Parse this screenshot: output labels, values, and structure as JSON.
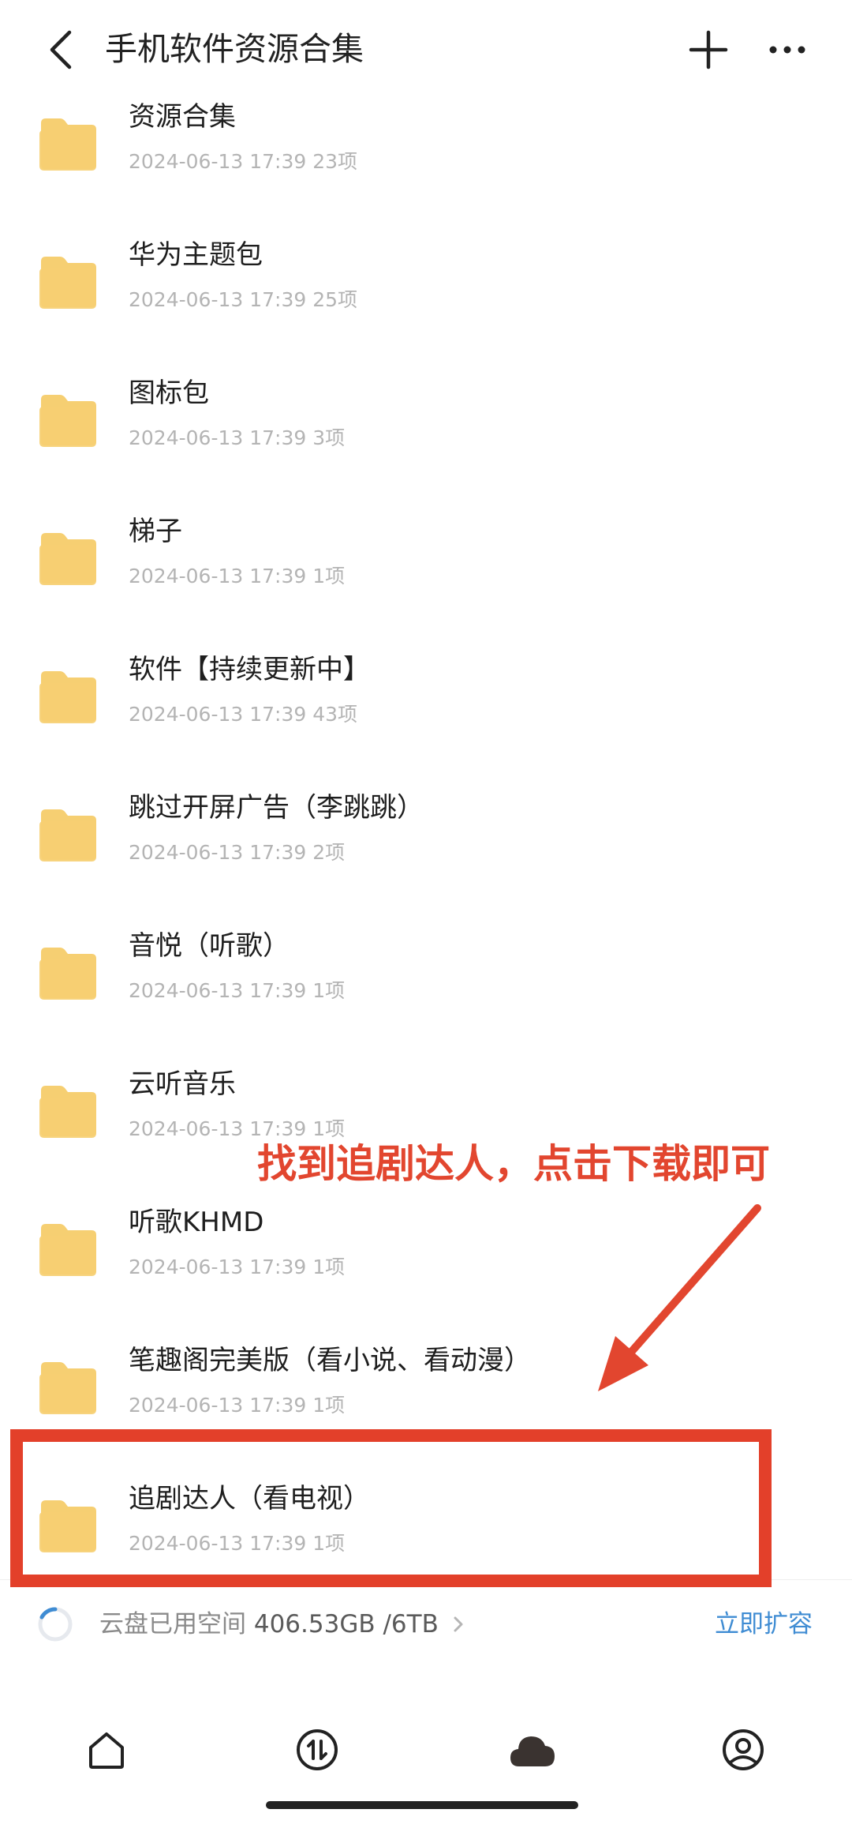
{
  "header": {
    "title": "手机软件资源合集",
    "back_icon": "chevron-left-icon",
    "add_icon": "plus-icon",
    "more_icon": "more-horizontal-icon"
  },
  "files": [
    {
      "name": "资源合集",
      "date": "2024-06-13 17:39",
      "count": "23项"
    },
    {
      "name": "华为主题包",
      "date": "2024-06-13 17:39",
      "count": "25项"
    },
    {
      "name": "图标包",
      "date": "2024-06-13 17:39",
      "count": "3项"
    },
    {
      "name": "梯子",
      "date": "2024-06-13 17:39",
      "count": "1项"
    },
    {
      "name": "软件【持续更新中】",
      "date": "2024-06-13 17:39",
      "count": "43项"
    },
    {
      "name": "跳过开屏广告（李跳跳）",
      "date": "2024-06-13 17:39",
      "count": "2项"
    },
    {
      "name": "音悦（听歌）",
      "date": "2024-06-13 17:39",
      "count": "1项"
    },
    {
      "name": "云听音乐",
      "date": "2024-06-13 17:39",
      "count": "1项"
    },
    {
      "name": "听歌KHMD",
      "date": "2024-06-13 17:39",
      "count": "1项"
    },
    {
      "name": "笔趣阁完美版（看小说、看动漫）",
      "date": "2024-06-13 17:39",
      "count": "1项"
    },
    {
      "name": "追剧达人（看电视）",
      "date": "2024-06-13 17:39",
      "count": "1项"
    }
  ],
  "annotation": {
    "text": "找到追剧达人，点击下载即可",
    "color": "#e2462f"
  },
  "storage": {
    "label": "云盘已用空间",
    "used": "406.53GB /6TB",
    "expand_label": "立即扩容",
    "accent": "#3f8cd3"
  },
  "bottom_nav": [
    {
      "icon": "home-icon"
    },
    {
      "icon": "transfer-icon"
    },
    {
      "icon": "cloud-icon",
      "active": true
    },
    {
      "icon": "profile-icon"
    }
  ],
  "colors": {
    "folder": "#f6cf72",
    "highlight_box": "#e3402a"
  }
}
